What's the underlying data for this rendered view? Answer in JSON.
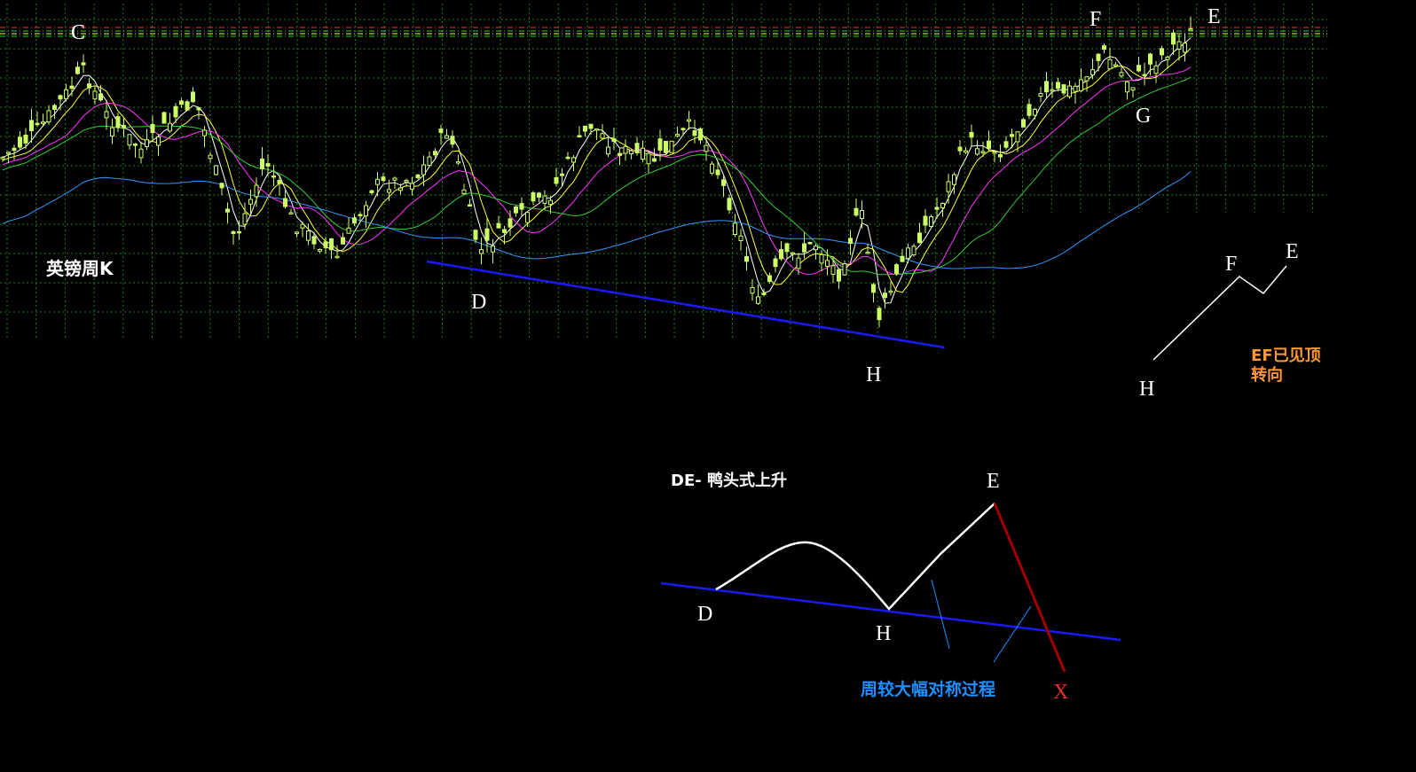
{
  "chart_data": {
    "type": "candlestick",
    "title": "英镑周K",
    "annotation_points": [
      "C",
      "D",
      "H",
      "F",
      "E",
      "G"
    ],
    "trendline_color": "#1a1aff",
    "moving_average_colors": [
      "#ffffff",
      "#ffff33",
      "#ff33ff",
      "#33cc33",
      "#3399ff"
    ],
    "candle_color": "#ccff66",
    "resistance_line_colors": [
      "#ff3333",
      "#33cc33",
      "#ffff33"
    ],
    "grid": true,
    "grid_color": "#1f7f1f",
    "diagrams": {
      "small": {
        "labels": [
          "H",
          "F",
          "E"
        ],
        "note": [
          "EF已见顶",
          "转向"
        ],
        "note_color": "#ff9933"
      },
      "large": {
        "title": "DE- 鸭头式上升",
        "labels": [
          "D",
          "H",
          "E",
          "X"
        ],
        "caption": "周较大幅对称过程",
        "caption_color": "#1e90ff",
        "x_color": "#e03030",
        "decline_color": "#a00000"
      }
    }
  }
}
